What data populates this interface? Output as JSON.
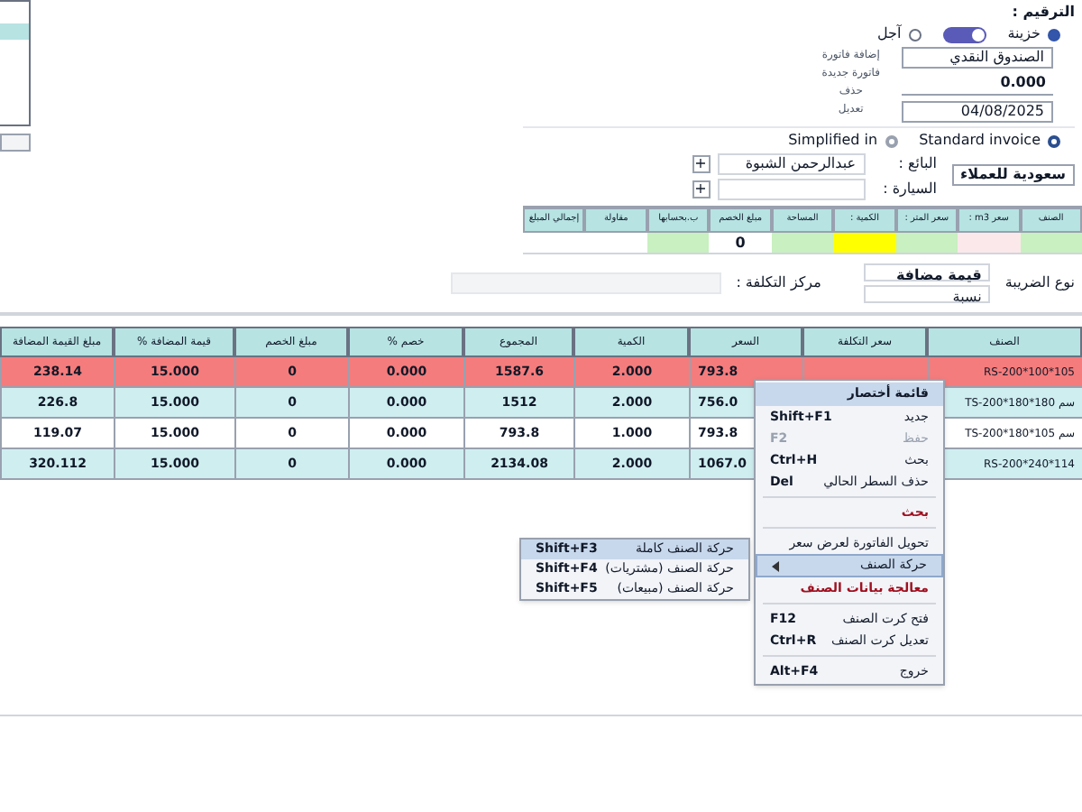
{
  "header": {
    "numbering_label": "الترقيم :",
    "payment": [
      {
        "label": "خزينة",
        "selected": true
      },
      {
        "label": "آجل",
        "selected": false
      }
    ],
    "toggle": {
      "on": true
    },
    "side_buttons": [
      "إضافة فاتورة",
      "فاتورة جديدة",
      "حذف",
      "تعديل"
    ],
    "cashbox": "الصندوق النقدي",
    "amount": "0.000",
    "date": "04/08/2025",
    "invoice_types": [
      {
        "label": "Standard invoice",
        "selected": true
      },
      {
        "label": "Simplified in",
        "selected": false
      }
    ],
    "salesperson_label": "البائع :",
    "salesperson": "عبدالرحمن الشبوة",
    "car_label": "السيارة :",
    "customer_group": "سعودية للعملاء",
    "add_buttons": [
      "+",
      "+"
    ]
  },
  "entry": {
    "columns": [
      {
        "label": "الصنف"
      },
      {
        "label": "سعر m3 :"
      },
      {
        "label": "سعر المتر :"
      },
      {
        "label": "الكمية :"
      },
      {
        "label": "المساحة"
      },
      {
        "label": "مبلغ الخصم",
        "value": "0"
      },
      {
        "label": "ب.بحسابها"
      },
      {
        "label": "مقاولة"
      },
      {
        "label": "إجمالي المبلغ"
      }
    ]
  },
  "tax": {
    "type_label": "نوع الضريبة",
    "type": "قيمة مضافة",
    "rate": "نسبة",
    "cost_center_label": "مركز التكلفة :"
  },
  "table": {
    "columns": [
      "الصنف",
      "سعر التكلفة",
      "السعر",
      "الكمية",
      "المجموع",
      "خصم %",
      "مبلغ الخصم",
      "قيمة المضافة %",
      "مبلغ القيمة المضافة"
    ],
    "rows": [
      {
        "selected": true,
        "cells": [
          "RS-200*100*105",
          "",
          "793.8",
          "2.000",
          "1587.6",
          "0.000",
          "0",
          "15.000",
          "238.14"
        ]
      },
      {
        "selected": false,
        "cells": [
          "TS-200*180*180 سم",
          "",
          "756.0",
          "2.000",
          "1512",
          "0.000",
          "0",
          "15.000",
          "226.8"
        ]
      },
      {
        "selected": false,
        "cells": [
          "TS-200*180*105 سم",
          "",
          "793.8",
          "1.000",
          "793.8",
          "0.000",
          "0",
          "15.000",
          "119.07"
        ]
      },
      {
        "selected": false,
        "cells": [
          "RS-200*240*114",
          "",
          "1067.0",
          "2.000",
          "2134.08",
          "0.000",
          "0",
          "15.000",
          "320.112"
        ]
      }
    ]
  },
  "context_menu": {
    "title": "قائمة أختصار",
    "items": [
      {
        "kind": "item",
        "label": "جديد",
        "shortcut": "Shift+F1",
        "disabled": false
      },
      {
        "kind": "item",
        "label": "حفظ",
        "shortcut": "F2",
        "disabled": true
      },
      {
        "kind": "item",
        "label": "بحث",
        "shortcut": "Ctrl+H",
        "disabled": false
      },
      {
        "kind": "item",
        "label": "حذف السطر الحالي",
        "shortcut": "Del",
        "disabled": false
      },
      {
        "kind": "separator"
      },
      {
        "kind": "accent",
        "label": "بحث"
      },
      {
        "kind": "separator"
      },
      {
        "kind": "item",
        "label": "تحويل الفاتورة لعرض سعر",
        "disabled": false
      },
      {
        "kind": "submenu",
        "label": "حركة الصنف",
        "selected": true
      },
      {
        "kind": "accent",
        "label": "معالجة بيانات الصنف"
      },
      {
        "kind": "separator"
      },
      {
        "kind": "item",
        "label": "فتح كرت الصنف",
        "shortcut": "F12",
        "disabled": false
      },
      {
        "kind": "item",
        "label": "تعديل كرت الصنف",
        "shortcut": "Ctrl+R",
        "disabled": false
      },
      {
        "kind": "separator"
      },
      {
        "kind": "item",
        "label": "خروج",
        "shortcut": "Alt+F4",
        "disabled": false
      }
    ],
    "submenu": [
      {
        "label": "حركة الصنف كاملة",
        "shortcut": "Shift+F3",
        "selected": true
      },
      {
        "label": "حركة الصنف (مشتريات)",
        "shortcut": "Shift+F4",
        "selected": false
      },
      {
        "label": "حركة الصنف (مبيعات)",
        "shortcut": "Shift+F5",
        "selected": false
      }
    ]
  }
}
